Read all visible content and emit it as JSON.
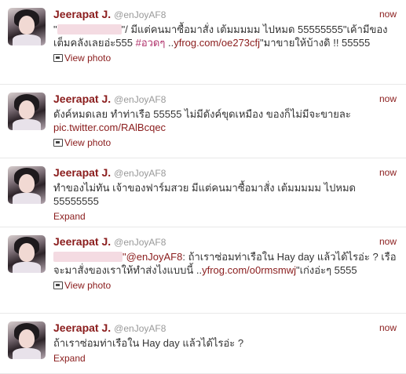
{
  "tweets": [
    {
      "name": "Jeerapat J.",
      "handle": "@enJoyAF8",
      "time": "now",
      "quote_open": "\"",
      "text_a": "\"/ มีแต่คนมาซื้อมาสั่ง เต้มมมมม ไปหมด 55555555\"เค้ามีของเต็มคลังเลยอ่ะ555 ",
      "hashtag": "#อวดๆ",
      "text_b": " ..",
      "link": "yfrog.com/oe273cfj",
      "text_c": "\"มาขายให้บ้างดิ !! 55555",
      "action": "View photo"
    },
    {
      "name": "Jeerapat J.",
      "handle": "@enJoyAF8",
      "time": "now",
      "text_a": "ดังค์หมดเลย ทำท่าเรือ 55555 ไม่มีดังค์ขุดเหมือง ของก็ไม่มีจะขายละ ",
      "link": "pic.twitter.com/RAlBcqec",
      "action": "View photo"
    },
    {
      "name": "Jeerapat J.",
      "handle": "@enJoyAF8",
      "time": "now",
      "text_a": "ทำของไม่ทัน เจ้าของฟาร์มสวย มีแต่คนมาซื้อมาสั่ง เต้มมมมม ไปหมด 55555555",
      "action": "Expand"
    },
    {
      "name": "Jeerapat J.",
      "handle": "@enJoyAF8",
      "time": "now",
      "mention": "\"@enJoyAF8",
      "text_a": ": ถ้าเราซ่อมท่าเรือใน Hay day แล้วได้ไรอ่ะ ? เรือจะมาสั่งของเราให้ทำส่งไงแบบนี้ ..",
      "link": "yfrog.com/o0rmsmwj",
      "text_c": "\"เก่งอ่ะๆ 5555",
      "action": "View photo"
    },
    {
      "name": "Jeerapat J.",
      "handle": "@enJoyAF8",
      "time": "now",
      "text_a": "ถ้าเราซ่อมท่าเรือใน Hay day แล้วได้ไรอ่ะ ?",
      "action": "Expand"
    }
  ]
}
